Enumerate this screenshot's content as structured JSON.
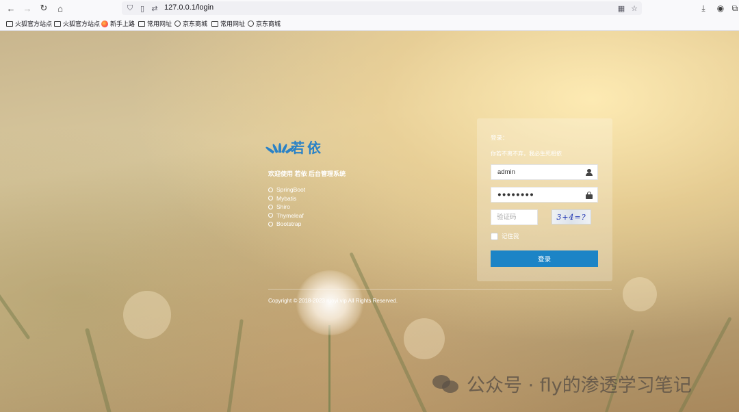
{
  "browser": {
    "url": "127.0.0.1/login",
    "bookmarks": [
      {
        "label": "火狐官方站点",
        "icon": "folder-icon"
      },
      {
        "label": "火狐官方站点",
        "icon": "folder-icon"
      },
      {
        "label": "新手上路",
        "icon": "firefox-icon"
      },
      {
        "label": "常用网址",
        "icon": "folder-icon"
      },
      {
        "label": "京东商城",
        "icon": "globe-icon"
      },
      {
        "label": "常用网址",
        "icon": "folder-icon"
      },
      {
        "label": "京东商城",
        "icon": "globe-icon"
      }
    ]
  },
  "brand": {
    "logo_text": "若依",
    "welcome": "欢迎使用 若依 后台管理系统",
    "tech_list": [
      "SpringBoot",
      "Mybatis",
      "Shiro",
      "Thymeleaf",
      "Bootstrap"
    ],
    "copyright": "Copyright © 2018-2023 ruoyi.vip All Rights Reserved."
  },
  "login": {
    "title": "登录：",
    "subtitle": "你若不离不弃，我必生死相依",
    "username_value": "admin",
    "password_value": "●●●●●●●●",
    "captcha_placeholder": "验证码",
    "captcha_image_text": "3+4=?",
    "remember_label": "记住我",
    "submit_label": "登录",
    "accent_color": "#1c84c6"
  },
  "watermark": {
    "text": "公众号 · fly的渗透学习笔记"
  }
}
